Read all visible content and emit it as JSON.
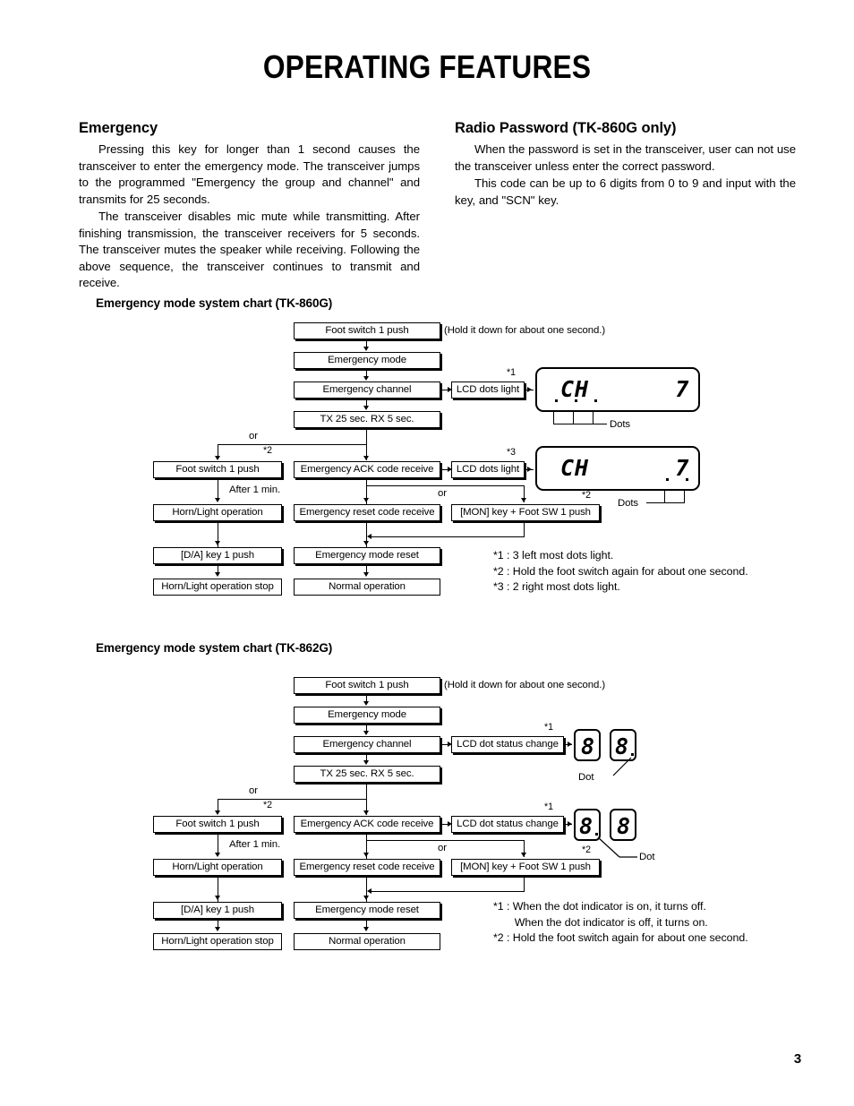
{
  "document": {
    "title": "OPERATING FEATURES",
    "page_number": "3"
  },
  "sections": {
    "emergency": {
      "heading": "Emergency",
      "paragraphs": [
        "Pressing this key for longer than 1 second causes the transceiver to enter the emergency mode.  The transceiver jumps to the programmed \"Emergency the group and channel\" and transmits for 25 seconds.",
        "The transceiver disables mic mute while transmitting.  After finishing transmission, the transceiver receivers for 5 seconds.  The transceiver mutes the speaker while receiving.  Following the above sequence, the transceiver continues to transmit and receive."
      ]
    },
    "radio_password": {
      "heading": "Radio Password (TK-860G only)",
      "paragraphs": [
        "When the password is set in the transceiver, user can not use the transceiver unless enter the correct password.",
        "This code can be up to 6 digits from 0 to 9 and input with the key, and \"SCN\" key."
      ]
    }
  },
  "chart1": {
    "heading": "Emergency mode system chart (TK-860G)",
    "boxes": {
      "foot_switch_top": "Foot switch 1 push",
      "emergency_mode": "Emergency mode",
      "emergency_channel": "Emergency channel",
      "tx_rx": "TX 25 sec.       RX 5 sec.",
      "lcd_dots_light_1": "LCD dots light",
      "foot_switch_left": "Foot switch 1 push",
      "emergency_ack": "Emergency ACK code receive",
      "lcd_dots_light_2": "LCD dots light",
      "horn_light": "Horn/Light operation",
      "emergency_reset_code": "Emergency reset code receive",
      "mon_key": "[MON] key + Foot SW 1 push",
      "da_key": "[D/A] key 1 push",
      "emergency_mode_reset": "Emergency mode reset",
      "horn_light_stop": "Horn/Light operation stop",
      "normal_operation": "Normal operation"
    },
    "annotations": {
      "hold_note": "(Hold it down for about one second.)",
      "or1": "or",
      "or2": "or",
      "star1": "*1",
      "star2_branch": "*2",
      "star3": "*3",
      "star2_mon": "*2",
      "after_1min": "After 1 min.",
      "dots_label_1": "Dots",
      "dots_label_2": "Dots"
    },
    "lcd": {
      "display_1": "CH      7",
      "display_2": "CH      7"
    },
    "notes": "*1 : 3 left most dots light.\n*2 : Hold the foot switch again for about one second.\n*3 : 2 right most dots light."
  },
  "chart2": {
    "heading": "Emergency mode system chart (TK-862G)",
    "boxes": {
      "foot_switch_top": "Foot switch 1 push",
      "emergency_mode": "Emergency mode",
      "emergency_channel": "Emergency channel",
      "tx_rx": "TX 25 sec.       RX 5 sec.",
      "lcd_dot_status_1": "LCD dot status change",
      "foot_switch_left": "Foot switch 1 push",
      "emergency_ack": "Emergency ACK code receive",
      "lcd_dot_status_2": "LCD dot status change",
      "horn_light": "Horn/Light operation",
      "emergency_reset_code": "Emergency reset code receive",
      "mon_key": "[MON] key + Foot SW 1 push",
      "da_key": "[D/A] key 1 push",
      "emergency_mode_reset": "Emergency mode reset",
      "horn_light_stop": "Horn/Light operation stop",
      "normal_operation": "Normal operation"
    },
    "annotations": {
      "hold_note": "(Hold it down for about one second.)",
      "or1": "or",
      "or2": "or",
      "star1_a": "*1",
      "star1_b": "*1",
      "star2_branch": "*2",
      "star2_mon": "*2",
      "after_1min": "After 1 min.",
      "dot_label_1": "Dot",
      "dot_label_2": "Dot"
    },
    "lcd": {
      "digit_1a": "8",
      "digit_1b": "8",
      "digit_2a": "8",
      "digit_2b": "8"
    },
    "notes": "*1 : When the dot indicator is on, it turns off.\n       When the dot indicator is off, it turns on.\n*2 : Hold the foot switch again for about one second."
  }
}
